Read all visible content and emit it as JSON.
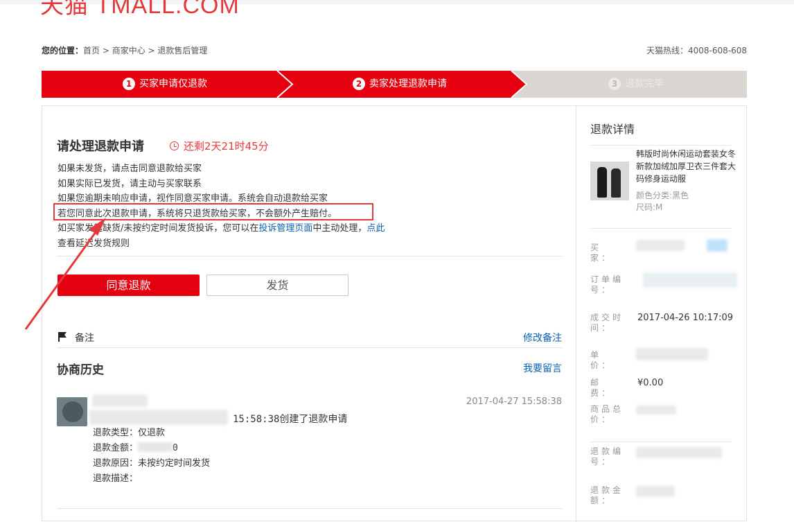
{
  "header": {
    "logo": "天猫 TMALL.COM"
  },
  "breadcrumb": {
    "label": "您的位置：",
    "path": "首页 > 商家中心 > 退款售后管理"
  },
  "hotline": "天猫热线：4008-608-608",
  "steps": [
    {
      "num": "1",
      "label": "买家申请仅退款"
    },
    {
      "num": "2",
      "label": "卖家处理退款申请"
    },
    {
      "num": "3",
      "label": "退款完毕"
    }
  ],
  "panel": {
    "title": "请处理退款申请",
    "countdown": "还剩2天21时45分",
    "tips": [
      "如果未发货，请点击同意退款给买家",
      "如果实际已发货，请主动与买家联系",
      "如果您逾期未响应申请，视作同意买家申请。系统会自动退款给买家",
      "若您同意此次退款申请，系统将只退货款给买家，不会额外产生赔付。"
    ],
    "tip5_prefix": "如买家发起缺货/未按约定时间发货投诉，您可以在",
    "tip5_link": "投诉管理页面",
    "tip5_mid": "中主动处理，",
    "tip5_link2": "点此",
    "tip6": "查看延迟发货规则",
    "agree_button": "同意退款",
    "ship_button": "发货",
    "note_label": "备注",
    "note_edit": "修改备注",
    "history_title": "协商历史",
    "history_msg_link": "我要留言",
    "history": {
      "time": "2017-04-27 15:58:38",
      "line": "15:58:38创建了退款申请",
      "type": "退款类型：仅退款",
      "amount": "退款金额：",
      "amount_tail": "0",
      "reason": "退款原因：未按约定时间发货",
      "desc": "退款描述："
    }
  },
  "detail": {
    "title": "退款详情",
    "product_name": "韩版时尚休闲运动套装女冬新款加绒加厚卫衣三件套大码修身运动服",
    "color": "颜色分类:黑色",
    "size": "尺码:M",
    "buyer_label": "买　家：",
    "order_label": "订单编号：",
    "deal_time_label": "成交时间：",
    "deal_time": "2017-04-26 10:17:09",
    "unit_price_label": "单　价：",
    "postage_label": "邮　费：",
    "postage": "¥0.00",
    "total_label": "商品总价：",
    "refund_no_label": "退款编号：",
    "refund_amount_label": "退款金额："
  }
}
